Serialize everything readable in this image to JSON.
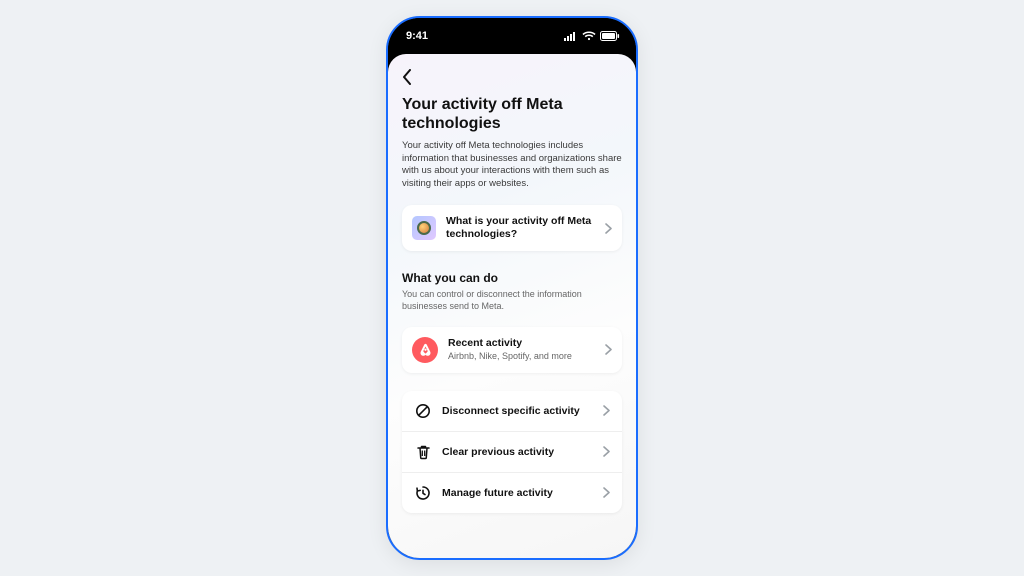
{
  "status": {
    "time": "9:41"
  },
  "page": {
    "title": "Your activity off Meta technologies",
    "description": "Your activity off Meta technologies includes information that businesses and organizations share with us about your interactions with them such as visiting their apps or websites."
  },
  "info_card": {
    "label": "What is your activity off Meta technologies?"
  },
  "section": {
    "title": "What you can do",
    "subtitle": "You can control or disconnect the information businesses send to Meta."
  },
  "recent": {
    "title": "Recent activity",
    "subtitle": "Airbnb, Nike, Spotify, and more"
  },
  "actions": [
    {
      "icon": "block",
      "label": "Disconnect specific activity"
    },
    {
      "icon": "trash",
      "label": "Clear previous activity"
    },
    {
      "icon": "clock",
      "label": "Manage future activity"
    }
  ]
}
